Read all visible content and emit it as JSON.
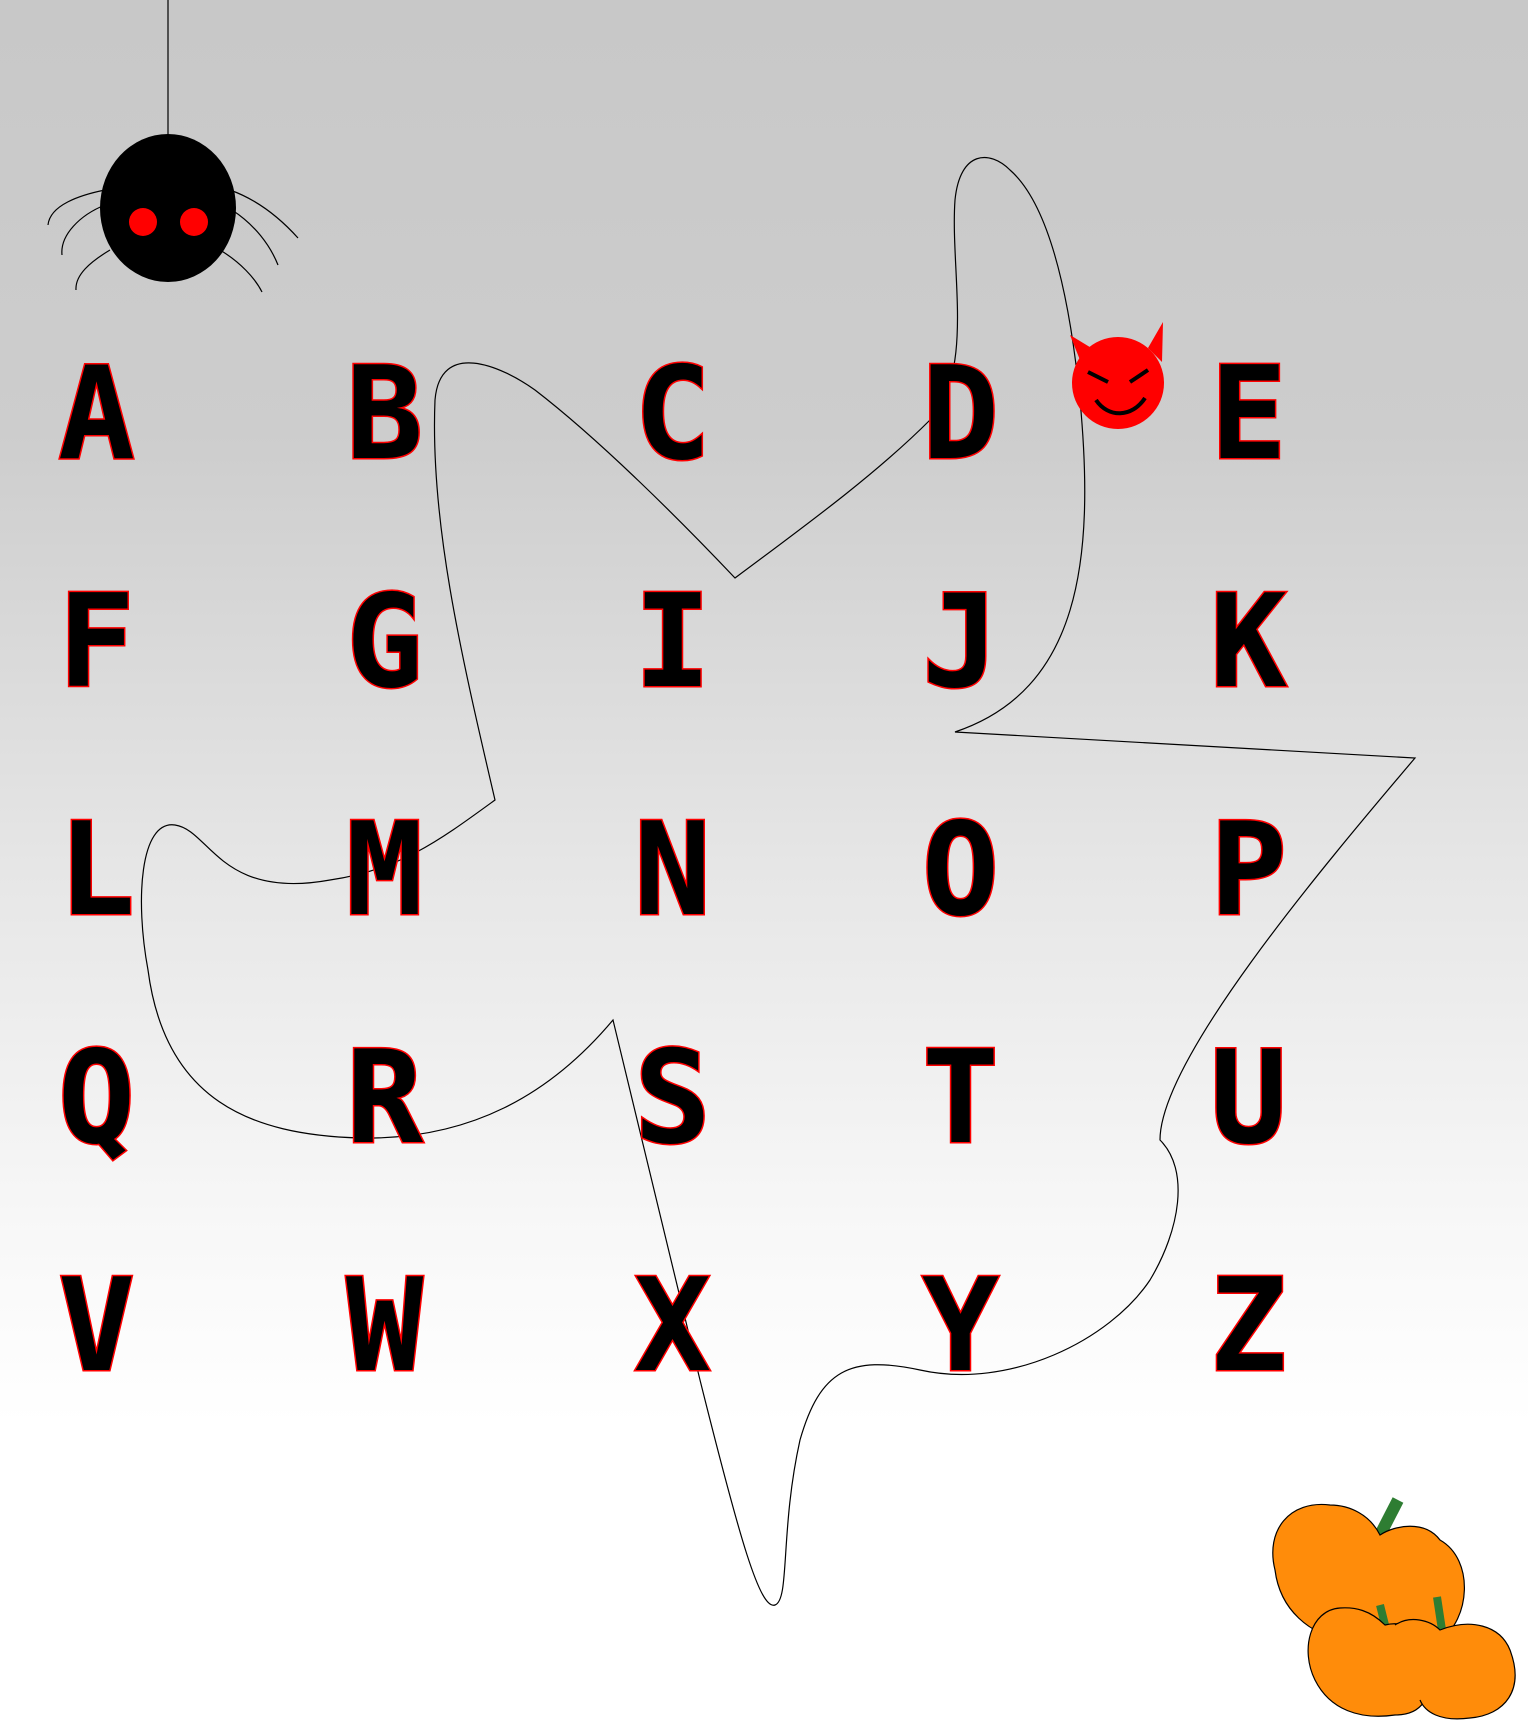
{
  "colors": {
    "glyph_fill": "#000000",
    "glyph_outline": "#ff0000",
    "spider_body": "#000000",
    "spider_eyes": "#ff0000",
    "devil_face": "#ff0000",
    "pumpkin": "#ff8c0a",
    "pumpkin_stem": "#2e7d32",
    "ghost_outline": "#000000"
  },
  "decorations": [
    "spider-icon",
    "ghost-icon",
    "devil-face-icon",
    "pumpkins-icon"
  ],
  "glyphs": [
    "A",
    "B",
    "C",
    "D",
    "E",
    "F",
    "G",
    "I",
    "J",
    "K",
    "L",
    "M",
    "N",
    "O",
    "P",
    "Q",
    "R",
    "S",
    "T",
    "U",
    "V",
    "W",
    "X",
    "Y",
    "Z"
  ]
}
